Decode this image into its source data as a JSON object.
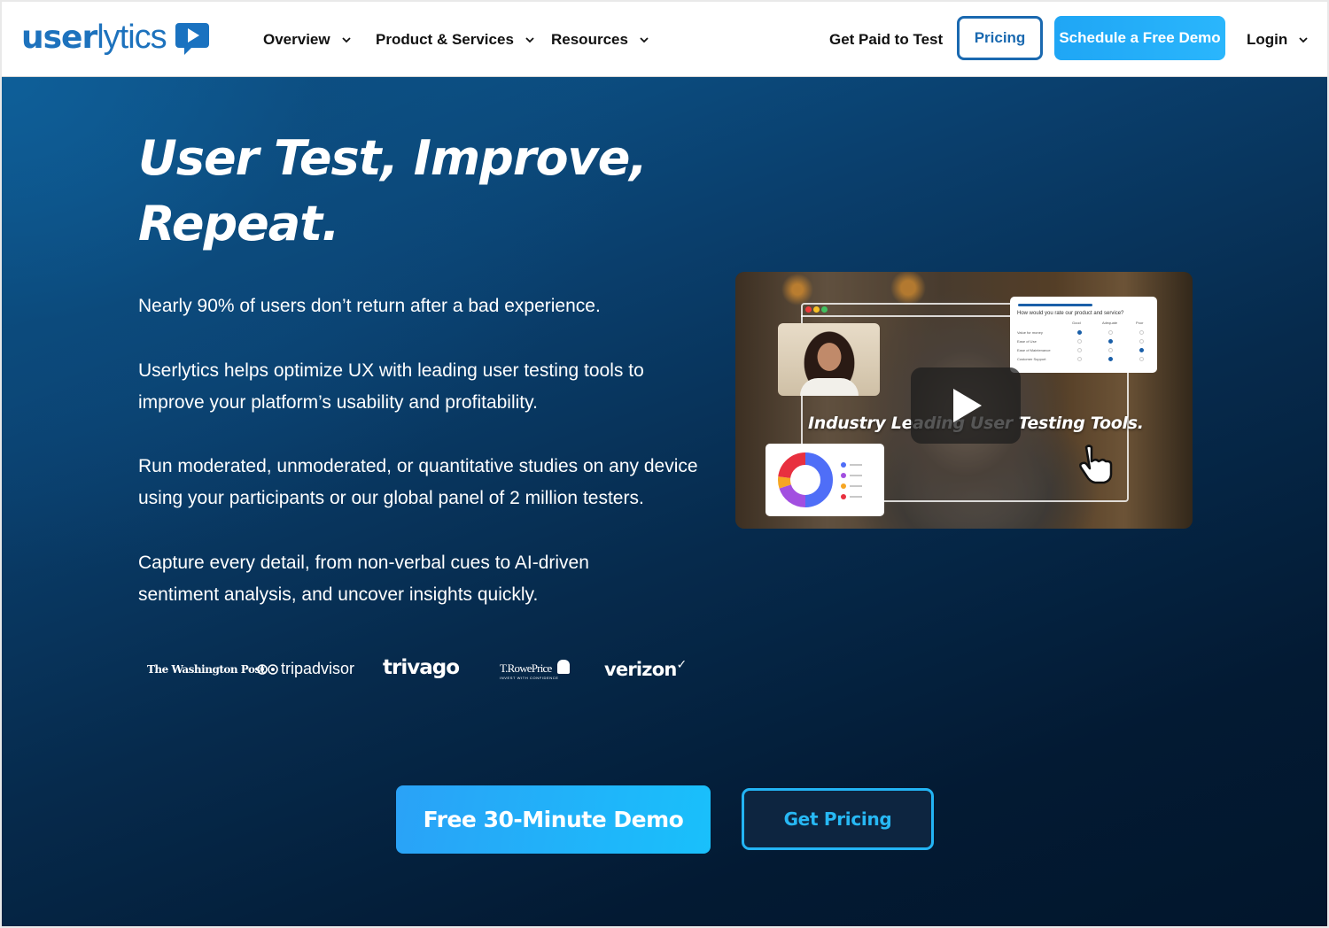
{
  "header": {
    "logo": {
      "part1": "user",
      "part2": "lytics",
      "icon": "play-chat-bubble-icon"
    },
    "nav": [
      {
        "label": "Overview",
        "has_dropdown": true
      },
      {
        "label": "Product & Services",
        "has_dropdown": true
      },
      {
        "label": "Resources",
        "has_dropdown": true
      }
    ],
    "get_paid_label": "Get Paid to Test",
    "pricing_label": "Pricing",
    "demo_label": "Schedule a Free Demo",
    "login_label": "Login"
  },
  "hero": {
    "title_line1": "User Test, Improve,",
    "title_line2": "Repeat.",
    "paragraphs": [
      "Nearly 90% of users don’t return after a bad experience.",
      "Userlytics helps optimize UX with leading user testing tools to improve your platform’s usability and profitability.",
      "Run moderated, unmoderated, or quantitative studies on any device using your participants or our global panel of 2 million testers.",
      "Capture every detail, from non-verbal cues to AI-driven sentiment analysis, and uncover insights quickly."
    ],
    "client_logos": [
      {
        "name": "The Washington Post",
        "text": "The Washington Post"
      },
      {
        "name": "Tripadvisor",
        "text": "tripadvisor"
      },
      {
        "name": "trivago",
        "text": "trivago"
      },
      {
        "name": "T. Rowe Price",
        "text": "T.RowePrice",
        "tagline": "INVEST WITH CONFIDENCE"
      },
      {
        "name": "Verizon",
        "text": "verizon"
      }
    ],
    "video": {
      "caption": "Industry Leading User Testing Tools.",
      "survey_question": "How would you rate our product and service?",
      "survey_columns": [
        "Good",
        "Adequate",
        "Poor"
      ],
      "survey_rows": [
        {
          "label": "Value for money",
          "selected": 0
        },
        {
          "label": "Ease of Use",
          "selected": 1
        },
        {
          "label": "Ease of Maintenance",
          "selected": 2
        },
        {
          "label": "Customer Support",
          "selected": 1
        }
      ],
      "donut_colors": [
        "#4f6ef7",
        "#a24fe0",
        "#f6a623",
        "#e8303f"
      ],
      "donut_shares": [
        0.5,
        0.2,
        0.07,
        0.23
      ]
    },
    "cta_primary": "Free 30-Minute Demo",
    "cta_secondary": "Get Pricing"
  },
  "colors": {
    "brand_blue": "#1d72bd",
    "accent_cyan": "#23b4f4",
    "hero_dark": "#02162c"
  }
}
